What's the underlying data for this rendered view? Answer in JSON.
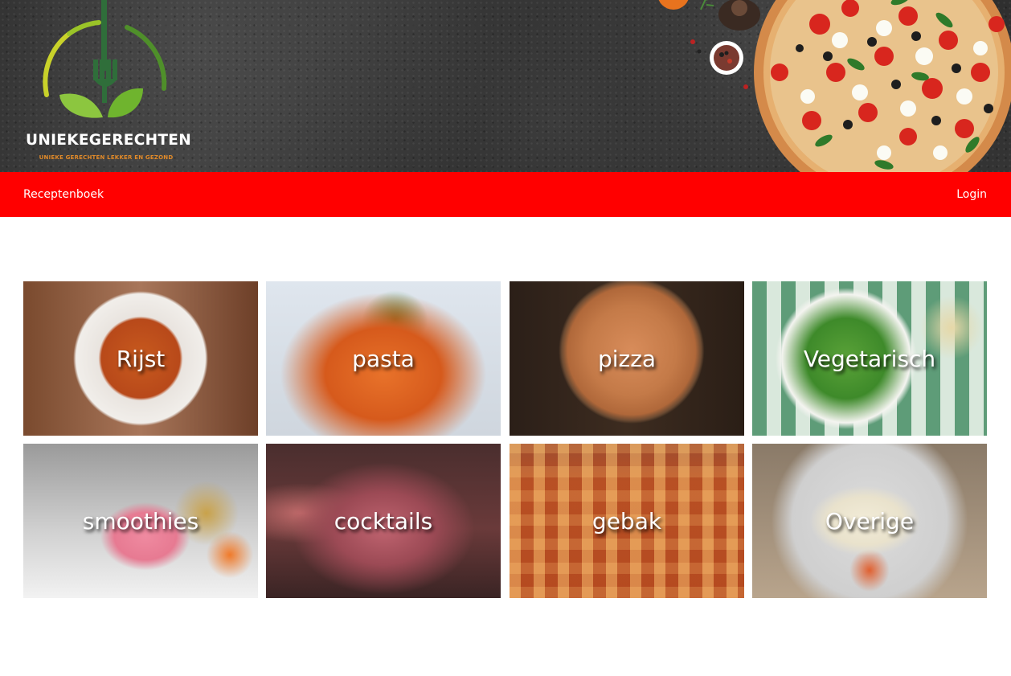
{
  "header": {
    "logo": {
      "wordmark": "UNIEKEGERECHTEN",
      "tagline": "UNIEKE GERECHTEN LEKKER EN GEZOND"
    }
  },
  "nav": {
    "home_label": "Receptenboek",
    "login_label": "Login",
    "bar_color": "#ff0000"
  },
  "categories": [
    {
      "label": "Rijst"
    },
    {
      "label": "pasta"
    },
    {
      "label": "pizza"
    },
    {
      "label": "Vegetarisch"
    },
    {
      "label": "smoothies"
    },
    {
      "label": "cocktails"
    },
    {
      "label": "gebak"
    },
    {
      "label": "Overige"
    }
  ]
}
